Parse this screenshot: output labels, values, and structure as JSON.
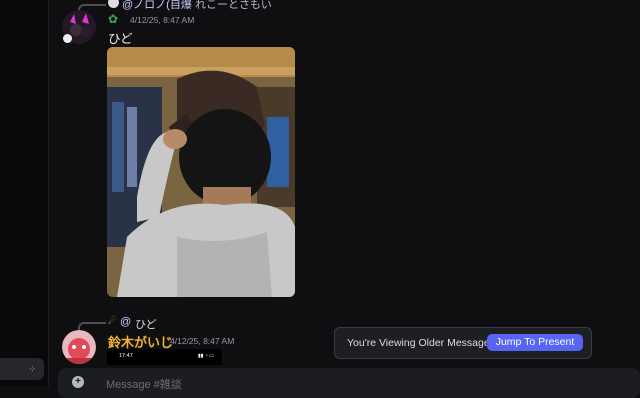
{
  "messages": [
    {
      "reply": {
        "username": "@ノロノ(自爆",
        "text": "れこーとさもい"
      },
      "timestamp": "4/12/25, 8:47 AM",
      "content": "ひど",
      "attachment": "photo"
    },
    {
      "reply": {
        "username": "@",
        "text": "ひど"
      },
      "username": "鈴木がいじ",
      "timestamp": "4/12/25, 8:47 AM",
      "attachment_preview": {
        "phone_time": "17:47"
      }
    }
  ],
  "older_messages_bar": {
    "text": "You're Viewing Older Messages",
    "button": "Jump To Present"
  },
  "composer": {
    "placeholder": "Message #雑談"
  },
  "colors": {
    "accent": "#5865f2",
    "mention": "#c9cdfb",
    "username_orange": "#f0b232",
    "background": "#0f0f12"
  },
  "icons": {
    "photo_subject": "person-in-cap",
    "badge": "verified-badge-icon"
  }
}
